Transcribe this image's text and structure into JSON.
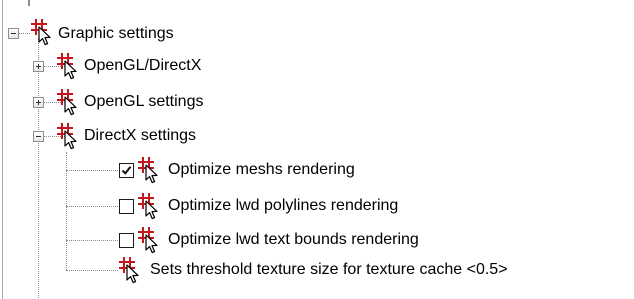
{
  "tree": {
    "graphic_settings": {
      "label": "Graphic settings",
      "icon": "settings-cursor-icon",
      "expanded": true,
      "children": {
        "opengl_directx": {
          "label": "OpenGL/DirectX",
          "expanded": false
        },
        "opengl_settings": {
          "label": "OpenGL settings",
          "expanded": false
        },
        "directx_settings": {
          "label": "DirectX settings",
          "expanded": true,
          "items": [
            {
              "label": "Optimize meshs rendering",
              "checked": true
            },
            {
              "label": "Optimize lwd polylines rendering",
              "checked": false
            },
            {
              "label": "Optimize lwd text bounds rendering",
              "checked": false
            },
            {
              "label": "Sets threshold texture size for texture cache <0.5>"
            }
          ]
        }
      }
    }
  },
  "colors": {
    "icon_red": "#c4161c",
    "line": "#8a8a8a"
  }
}
